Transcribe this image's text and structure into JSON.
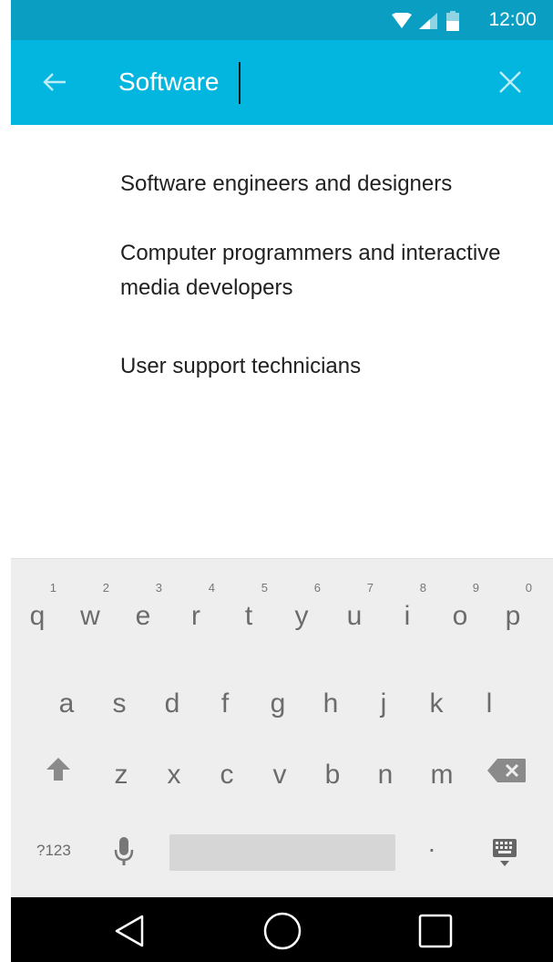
{
  "status_bar": {
    "time": "12:00"
  },
  "search": {
    "value": "Software"
  },
  "suggestions": [
    {
      "label": "Software engineers and designers"
    },
    {
      "label": "Computer programmers and interactive media developers"
    },
    {
      "label": "User support technicians"
    }
  ],
  "keyboard": {
    "row1": [
      {
        "key": "q",
        "hint": "1"
      },
      {
        "key": "w",
        "hint": "2"
      },
      {
        "key": "e",
        "hint": "3"
      },
      {
        "key": "r",
        "hint": "4"
      },
      {
        "key": "t",
        "hint": "5"
      },
      {
        "key": "y",
        "hint": "6"
      },
      {
        "key": "u",
        "hint": "7"
      },
      {
        "key": "i",
        "hint": "8"
      },
      {
        "key": "o",
        "hint": "9"
      },
      {
        "key": "p",
        "hint": "0"
      }
    ],
    "row2": [
      "a",
      "s",
      "d",
      "f",
      "g",
      "h",
      "j",
      "k",
      "l"
    ],
    "row3": [
      "z",
      "x",
      "c",
      "v",
      "b",
      "n",
      "m"
    ],
    "symbols_label": "?123",
    "period_label": "."
  },
  "colors": {
    "status_bar": "#0a9fc2",
    "app_bar": "#03b6e0",
    "keyboard_bg": "#eeeeee",
    "nav_bar": "#000000"
  },
  "icons": [
    "wifi-icon",
    "signal-icon",
    "battery-icon",
    "back-arrow-icon",
    "clear-icon",
    "shift-icon",
    "backspace-icon",
    "mic-icon",
    "keyboard-icon",
    "nav-back-icon",
    "nav-home-icon",
    "nav-recents-icon"
  ]
}
